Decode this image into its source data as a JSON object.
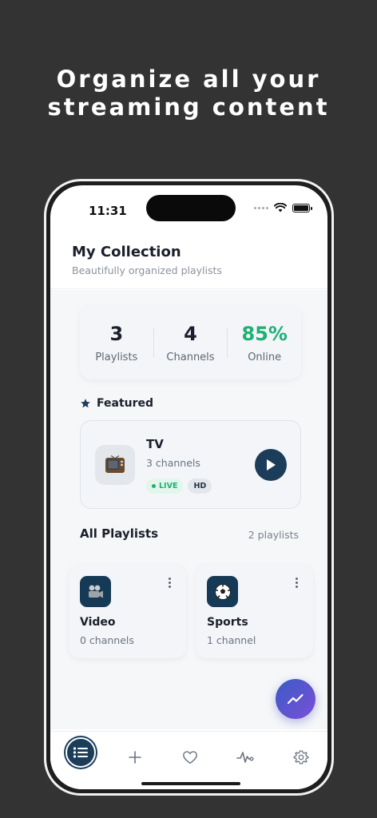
{
  "promo": {
    "line1": "Organize all your",
    "line2": "streaming content"
  },
  "status_bar": {
    "time": "11:31"
  },
  "header": {
    "title": "My Collection",
    "subtitle": "Beautifully organized playlists"
  },
  "stats": [
    {
      "value": "3",
      "label": "Playlists"
    },
    {
      "value": "4",
      "label": "Channels"
    },
    {
      "value": "85%",
      "label": "Online"
    }
  ],
  "featured": {
    "heading": "Featured",
    "title": "TV",
    "subtitle": "3 channels",
    "badge_live": "LIVE",
    "badge_hd": "HD",
    "icon": "tv-icon"
  },
  "all_playlists": {
    "heading": "All Playlists",
    "count": "2 playlists",
    "items": [
      {
        "title": "Video",
        "subtitle": "0 channels",
        "icon": "film-camera-icon"
      },
      {
        "title": "Sports",
        "subtitle": "1 channel",
        "icon": "soccer-ball-icon"
      }
    ]
  },
  "fab": {
    "icon": "trending-up-icon"
  },
  "tabbar": {
    "items": [
      {
        "icon": "list-icon",
        "active": true
      },
      {
        "icon": "plus-icon",
        "active": false
      },
      {
        "icon": "heart-icon",
        "active": false
      },
      {
        "icon": "activity-icon",
        "active": false
      },
      {
        "icon": "gear-icon",
        "active": false
      }
    ]
  },
  "colors": {
    "background": "#333333",
    "accent_navy": "#1c3d5a",
    "online_green": "#1fb074",
    "fab_gradient_start": "#3a5bc7",
    "fab_gradient_end": "#7b4fd6"
  }
}
